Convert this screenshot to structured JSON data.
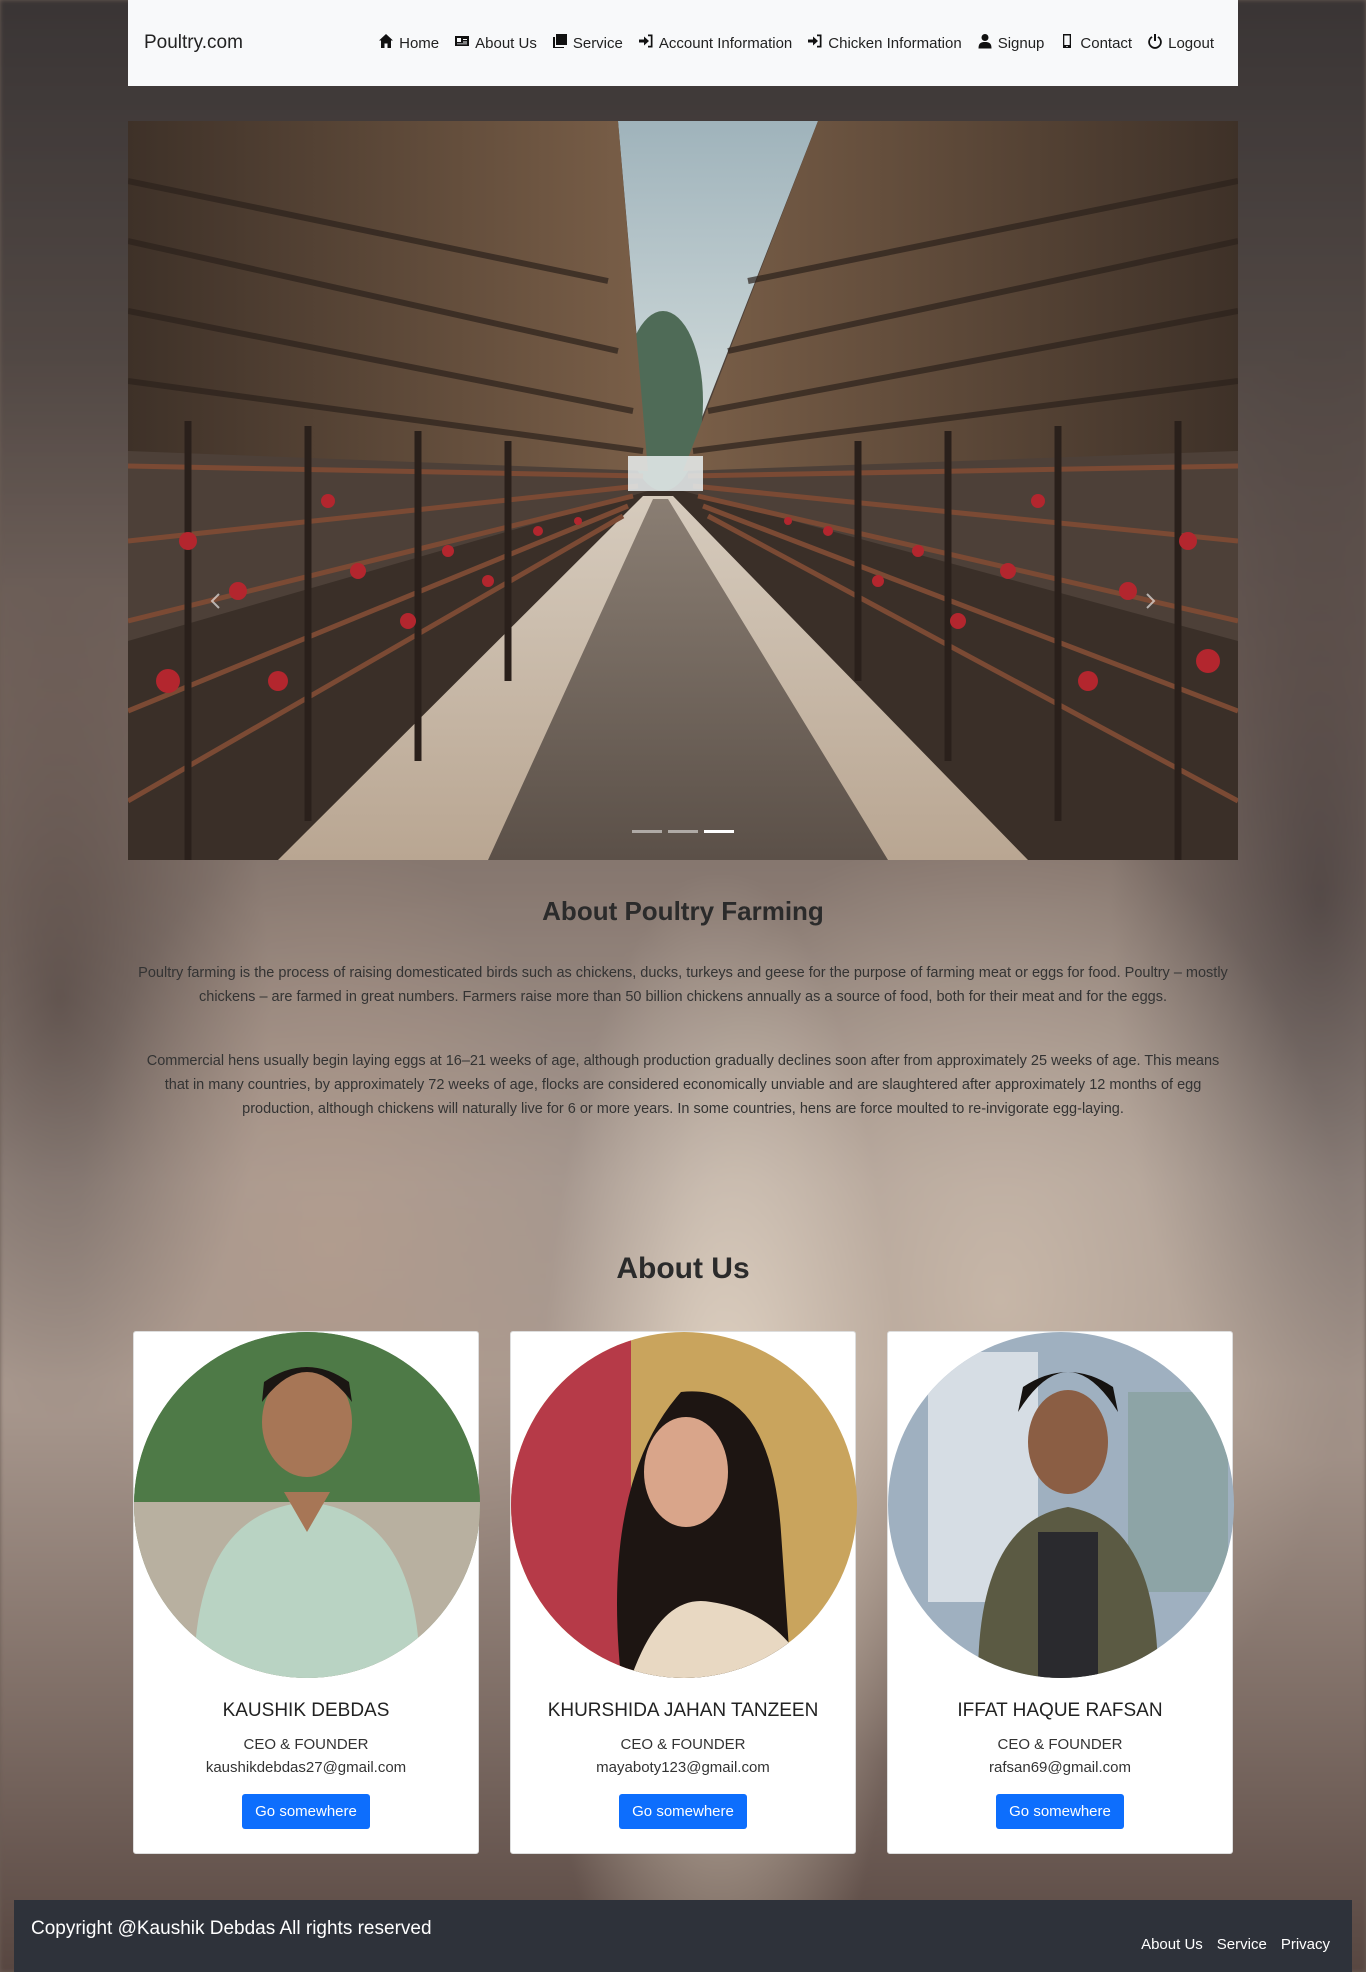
{
  "navbar": {
    "brand": "Poultry.com",
    "links": [
      {
        "label": "Home",
        "icon": "home-icon"
      },
      {
        "label": "About Us",
        "icon": "id-card-icon"
      },
      {
        "label": "Service",
        "icon": "copy-icon"
      },
      {
        "label": "Account Information",
        "icon": "sign-in-icon"
      },
      {
        "label": "Chicken Information",
        "icon": "sign-in-icon"
      },
      {
        "label": "Signup",
        "icon": "user-icon"
      },
      {
        "label": "Contact",
        "icon": "mobile-icon"
      },
      {
        "label": "Logout",
        "icon": "power-icon"
      }
    ]
  },
  "carousel": {
    "slide_count": 3,
    "active_slide": 3
  },
  "about": {
    "title": "About Poultry Farming",
    "paragraph1": "Poultry farming is the process of raising domesticated birds such as chickens, ducks, turkeys and geese for the purpose of farming meat or eggs for food. Poultry – mostly chickens – are farmed in great numbers. Farmers raise more than 50 billion chickens annually as a source of food, both for their meat and for the eggs.",
    "paragraph2": "Commercial hens usually begin laying eggs at 16–21 weeks of age, although production gradually declines soon after from approximately 25 weeks of age. This means that in many countries, by approximately 72 weeks of age, flocks are considered economically unviable and are slaughtered after approximately 12 months of egg production, although chickens will naturally live for 6 or more years. In some countries, hens are force moulted to re-invigorate egg-laying."
  },
  "team": {
    "title": "About Us",
    "members": [
      {
        "name": "KAUSHIK DEBDAS",
        "role": "CEO & FOUNDER",
        "email": "kaushikdebdas27@gmail.com",
        "button": "Go somewhere"
      },
      {
        "name": "KHURSHIDA JAHAN TANZEEN",
        "role": "CEO & FOUNDER",
        "email": "mayaboty123@gmail.com",
        "button": "Go somewhere"
      },
      {
        "name": "IFFAT HAQUE RAFSAN",
        "role": "CEO & FOUNDER",
        "email": "rafsan69@gmail.com",
        "button": "Go somewhere"
      }
    ]
  },
  "footer": {
    "copyright": "Copyright @Kaushik Debdas All rights reserved",
    "links": [
      "About Us",
      "Service",
      "Privacy"
    ]
  },
  "colors": {
    "primary_button": "#0d6efd",
    "navbar_bg": "#f8f9fa",
    "footer_bg": "#2e323a"
  }
}
